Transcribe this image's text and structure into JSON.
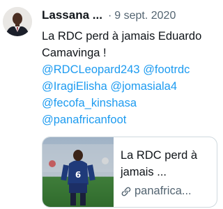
{
  "tweet": {
    "author_name": "Lassana ...",
    "separator": "·",
    "date": "9 sept. 2020",
    "text_lines": [
      "La RDC perd à jamais Eduardo",
      "Camavinga !"
    ],
    "mention_lines": [
      [
        "@RDCLeopard243",
        "@footrdc"
      ],
      [
        "@IragiElisha",
        "@jomasiala4"
      ],
      [
        "@fecofa_kinshasa"
      ],
      [
        "@panafricanfoot"
      ]
    ]
  },
  "link_card": {
    "title_lines": [
      "La RDC perd à",
      "jamais ..."
    ],
    "domain": "panafrica...",
    "thumb_jersey_number": "6"
  },
  "icons": {
    "link": "link-icon",
    "avatar": "avatar-photo"
  },
  "colors": {
    "mention": "#1d9bf0",
    "secondary_text": "#536471",
    "card_border": "#cfd9de"
  }
}
